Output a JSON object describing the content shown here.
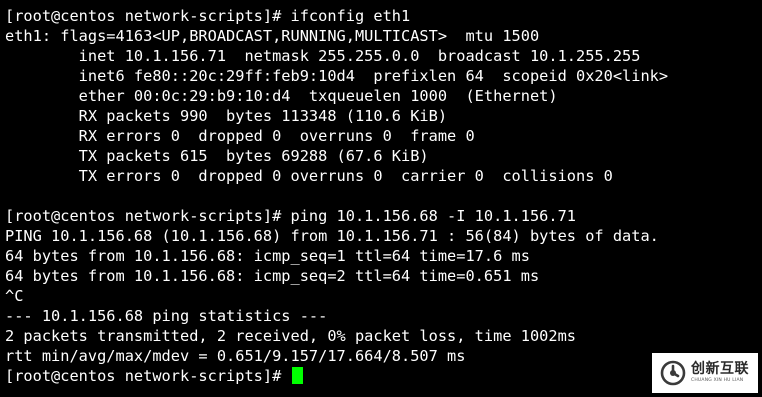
{
  "terminal": {
    "lines": [
      "[root@centos network-scripts]# ifconfig eth1",
      "eth1: flags=4163<UP,BROADCAST,RUNNING,MULTICAST>  mtu 1500",
      "        inet 10.1.156.71  netmask 255.255.0.0  broadcast 10.1.255.255",
      "        inet6 fe80::20c:29ff:feb9:10d4  prefixlen 64  scopeid 0x20<link>",
      "        ether 00:0c:29:b9:10:d4  txqueuelen 1000  (Ethernet)",
      "        RX packets 990  bytes 113348 (110.6 KiB)",
      "        RX errors 0  dropped 0  overruns 0  frame 0",
      "        TX packets 615  bytes 69288 (67.6 KiB)",
      "        TX errors 0  dropped 0 overruns 0  carrier 0  collisions 0",
      "",
      "[root@centos network-scripts]# ping 10.1.156.68 -I 10.1.156.71",
      "PING 10.1.156.68 (10.1.156.68) from 10.1.156.71 : 56(84) bytes of data.",
      "64 bytes from 10.1.156.68: icmp_seq=1 ttl=64 time=17.6 ms",
      "64 bytes from 10.1.156.68: icmp_seq=2 ttl=64 time=0.651 ms",
      "^C",
      "--- 10.1.156.68 ping statistics ---",
      "2 packets transmitted, 2 received, 0% packet loss, time 1002ms",
      "rtt min/avg/max/mdev = 0.651/9.157/17.664/8.507 ms"
    ],
    "prompt": "[root@centos network-scripts]# ",
    "text_color": "#ffffff",
    "background_color": "#000000",
    "cursor_color": "#00ff00"
  },
  "watermark": {
    "name": "创新互联",
    "subtitle": "CHUANG XIN HU LIAN",
    "icon": "brand-logo-icon"
  }
}
